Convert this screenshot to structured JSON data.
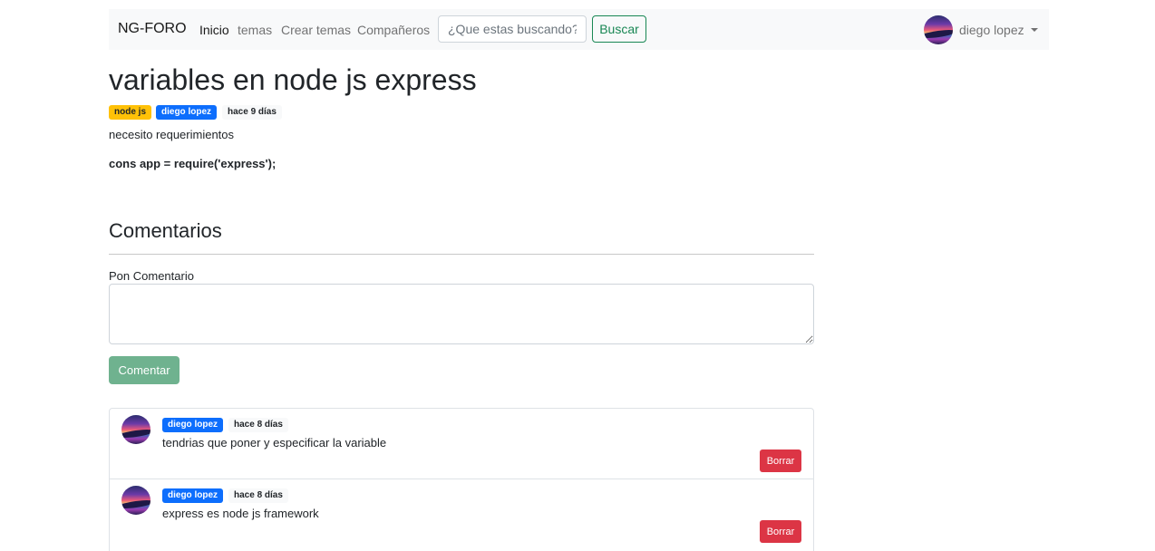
{
  "navbar": {
    "brand": "NG-FORO",
    "links": [
      {
        "label": "Inicio",
        "active": true
      },
      {
        "label": "temas",
        "active": false
      },
      {
        "label": "Crear temas",
        "active": false
      },
      {
        "label": "Compañeros",
        "active": false
      }
    ],
    "search": {
      "placeholder": "¿Que estas buscando?",
      "value": "",
      "button_label": "Buscar"
    },
    "user": {
      "name": "diego lopez",
      "avatar_icon": "user-avatar-icon",
      "menu_icon": "caret-down-icon"
    }
  },
  "post": {
    "title": "variables en node js express",
    "badges": {
      "tag": "node js",
      "author": "diego lopez",
      "time": "hace 9 días"
    },
    "description": "necesito requerimientos",
    "code": "cons app = require('express');"
  },
  "comments": {
    "heading": "Comentarios",
    "form": {
      "label": "Pon Comentario",
      "value": "",
      "button_label": "Comentar"
    },
    "items": [
      {
        "author": "diego lopez",
        "time": "hace 8 días",
        "text": "tendrias que poner y especificar la variable",
        "delete_label": "Borrar"
      },
      {
        "author": "diego lopez",
        "time": "hace 8 días",
        "text": "express es node js framework",
        "delete_label": "Borrar"
      }
    ]
  },
  "colors": {
    "primary": "#0d6efd",
    "warning": "#ffc107",
    "success": "#198754",
    "danger": "#dc3545",
    "navbar_bg": "#f8f9fa"
  }
}
